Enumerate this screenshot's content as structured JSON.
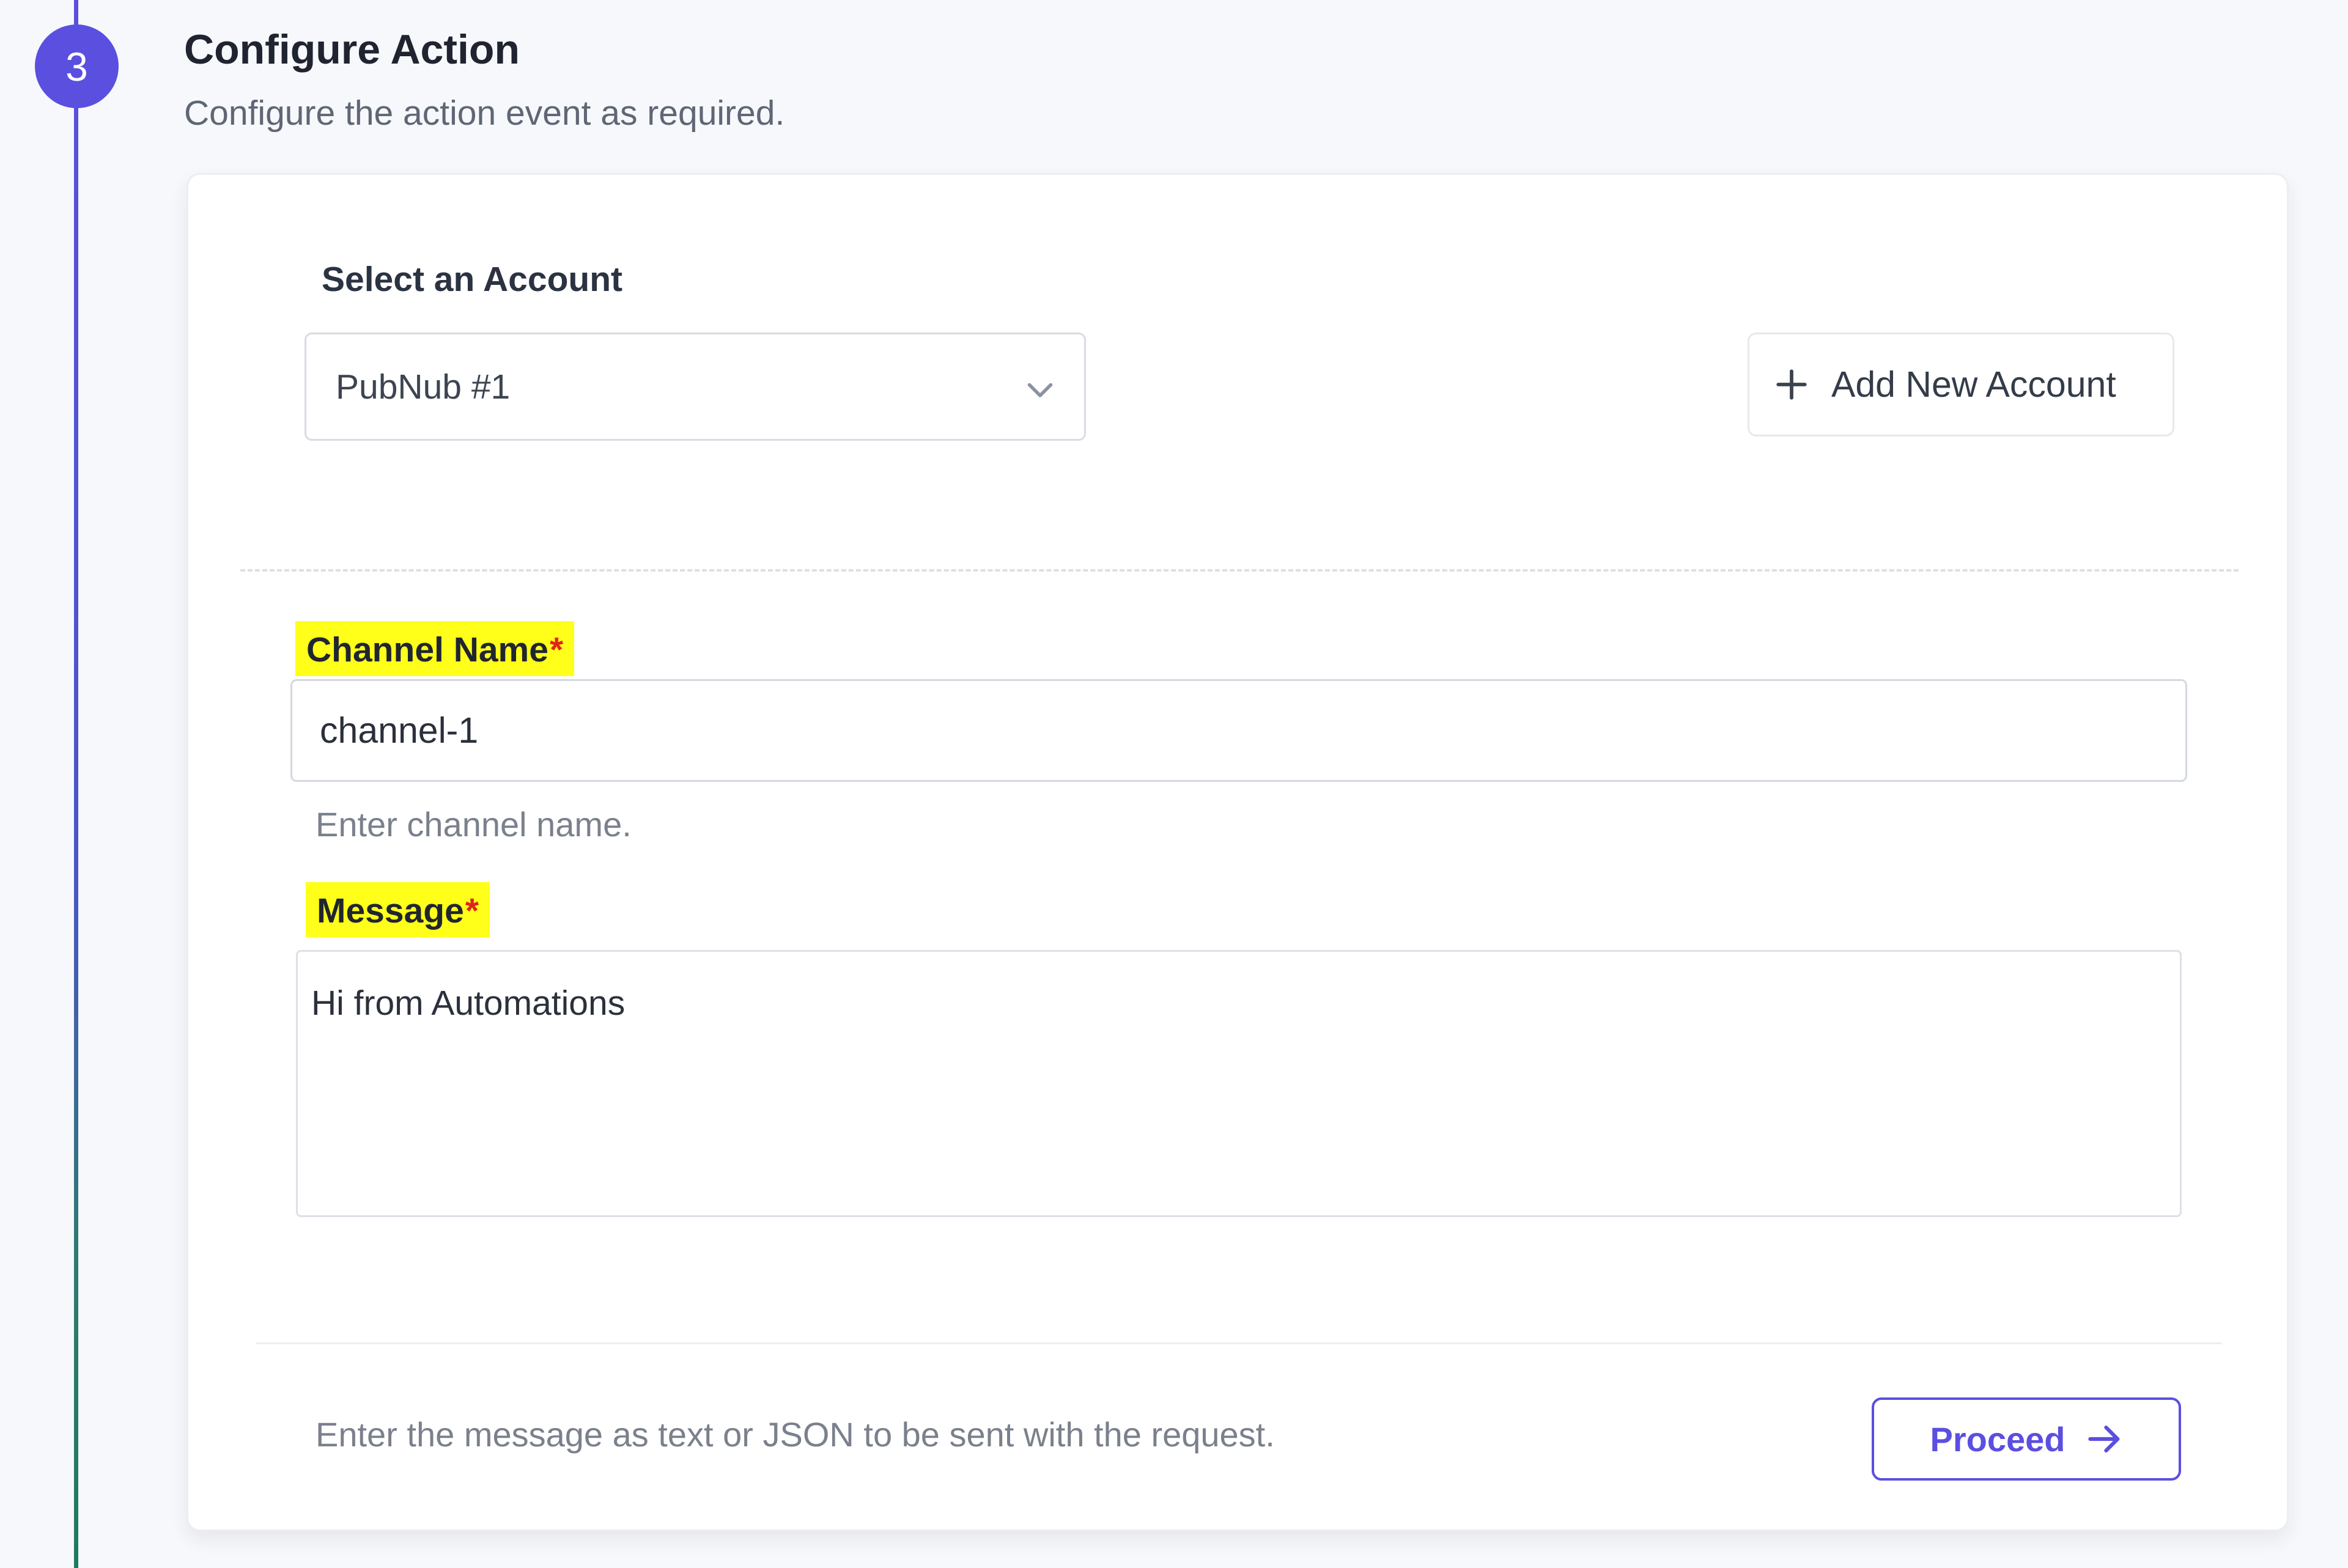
{
  "step": {
    "number": "3",
    "title": "Configure Action",
    "subtitle": "Configure the action event as required."
  },
  "account": {
    "label": "Select an Account",
    "selected": "PubNub #1",
    "add_label": "Add New Account"
  },
  "fields": {
    "channel": {
      "label": "Channel Name",
      "required_mark": "*",
      "value": "channel-1",
      "help": "Enter channel name."
    },
    "message": {
      "label": "Message",
      "required_mark": "*",
      "value": "Hi from Automations",
      "help": "Enter the message as text or JSON to be sent with the request."
    }
  },
  "actions": {
    "proceed_label": "Proceed"
  },
  "icons": {
    "chevron": "chevron-down-icon",
    "plus": "plus-icon",
    "arrow": "arrow-right-icon"
  },
  "colors": {
    "accent": "#5b4fe0",
    "highlight": "#ffff1a",
    "required": "#e0241b"
  }
}
